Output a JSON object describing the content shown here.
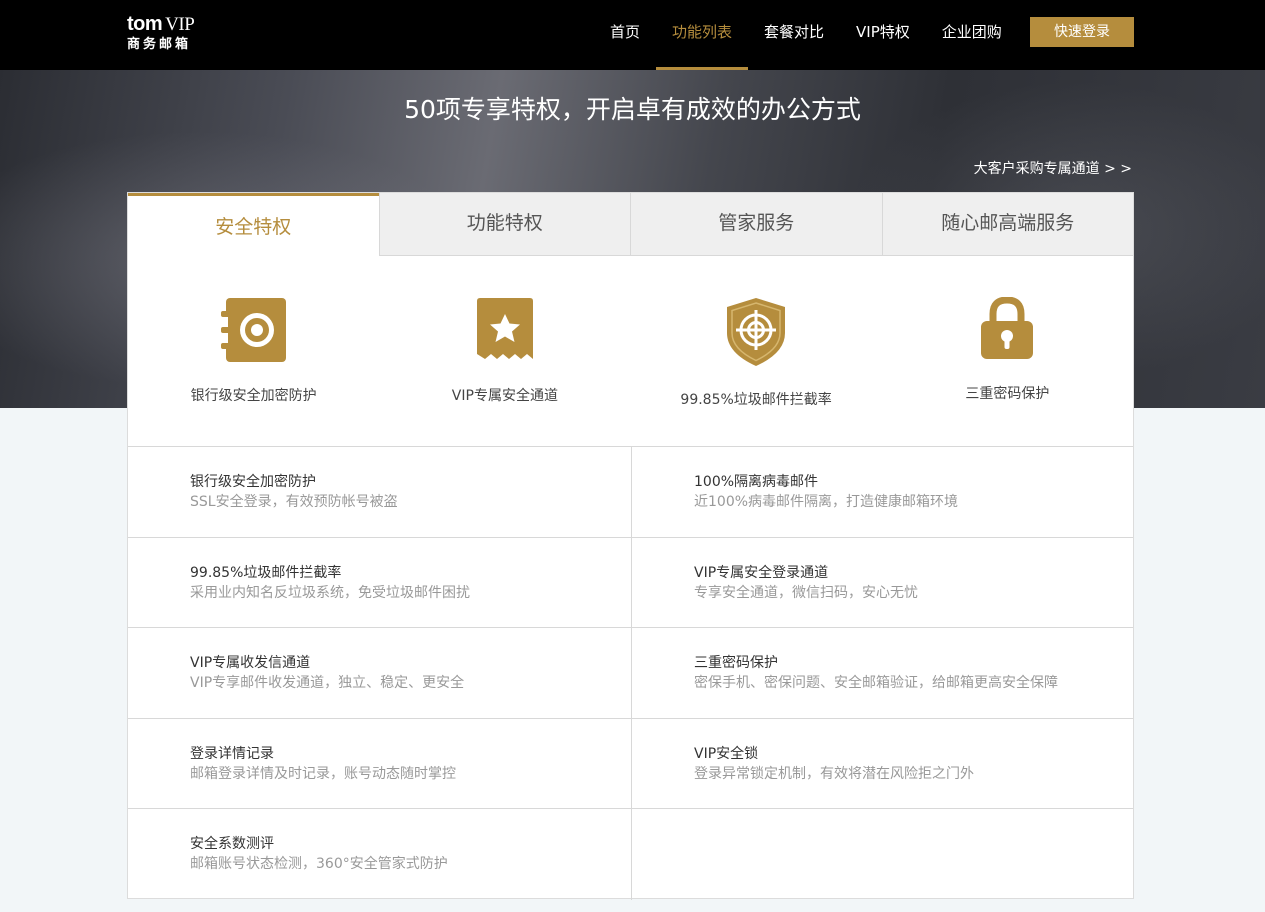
{
  "brand": {
    "logo_top": "tom",
    "logo_vip": "VIP",
    "logo_bottom": "商务邮箱"
  },
  "nav": {
    "items": [
      {
        "label": "首页"
      },
      {
        "label": "功能列表"
      },
      {
        "label": "套餐对比"
      },
      {
        "label": "VIP特权"
      },
      {
        "label": "企业团购"
      }
    ],
    "active": "功能列表",
    "login_label": "快速登录"
  },
  "hero": {
    "title": "50项专享特权，开启卓有成效的办公方式",
    "link_label": "大客户采购专属通道 > >"
  },
  "tabs": [
    {
      "label": "安全特权"
    },
    {
      "label": "功能特权"
    },
    {
      "label": "管家服务"
    },
    {
      "label": "随心邮高端服务"
    }
  ],
  "active_tab": "安全特权",
  "highlights": [
    {
      "icon": "safe-icon",
      "label": "银行级安全加密防护"
    },
    {
      "icon": "vip-star-ticket-icon",
      "label": "VIP专属安全通道"
    },
    {
      "icon": "shield-target-icon",
      "label": "99.85%垃圾邮件拦截率"
    },
    {
      "icon": "padlock-icon",
      "label": "三重密码保护"
    }
  ],
  "features": [
    {
      "title": "银行级安全加密防护",
      "desc": "SSL安全登录，有效预防帐号被盗"
    },
    {
      "title": "100%隔离病毒邮件",
      "desc": "近100%病毒邮件隔离，打造健康邮箱环境"
    },
    {
      "title": "99.85%垃圾邮件拦截率",
      "desc": "采用业内知名反垃圾系统，免受垃圾邮件困扰"
    },
    {
      "title": "VIP专属安全登录通道",
      "desc": "专享安全通道，微信扫码，安心无忧"
    },
    {
      "title": "VIP专属收发信通道",
      "desc": "VIP专享邮件收发通道，独立、稳定、更安全"
    },
    {
      "title": "三重密码保护",
      "desc": "密保手机、密保问题、安全邮箱验证，给邮箱更高安全保障"
    },
    {
      "title": "登录详情记录",
      "desc": "邮箱登录详情及时记录，账号动态随时掌控"
    },
    {
      "title": "VIP安全锁",
      "desc": "登录异常锁定机制，有效将潜在风险拒之门外"
    },
    {
      "title": "安全系数测评",
      "desc": "邮箱账号状态检测，360°安全管家式防护"
    }
  ],
  "colors": {
    "accent": "#b58d3d",
    "header_bg": "#000000",
    "page_bg": "#f2f6f8"
  }
}
